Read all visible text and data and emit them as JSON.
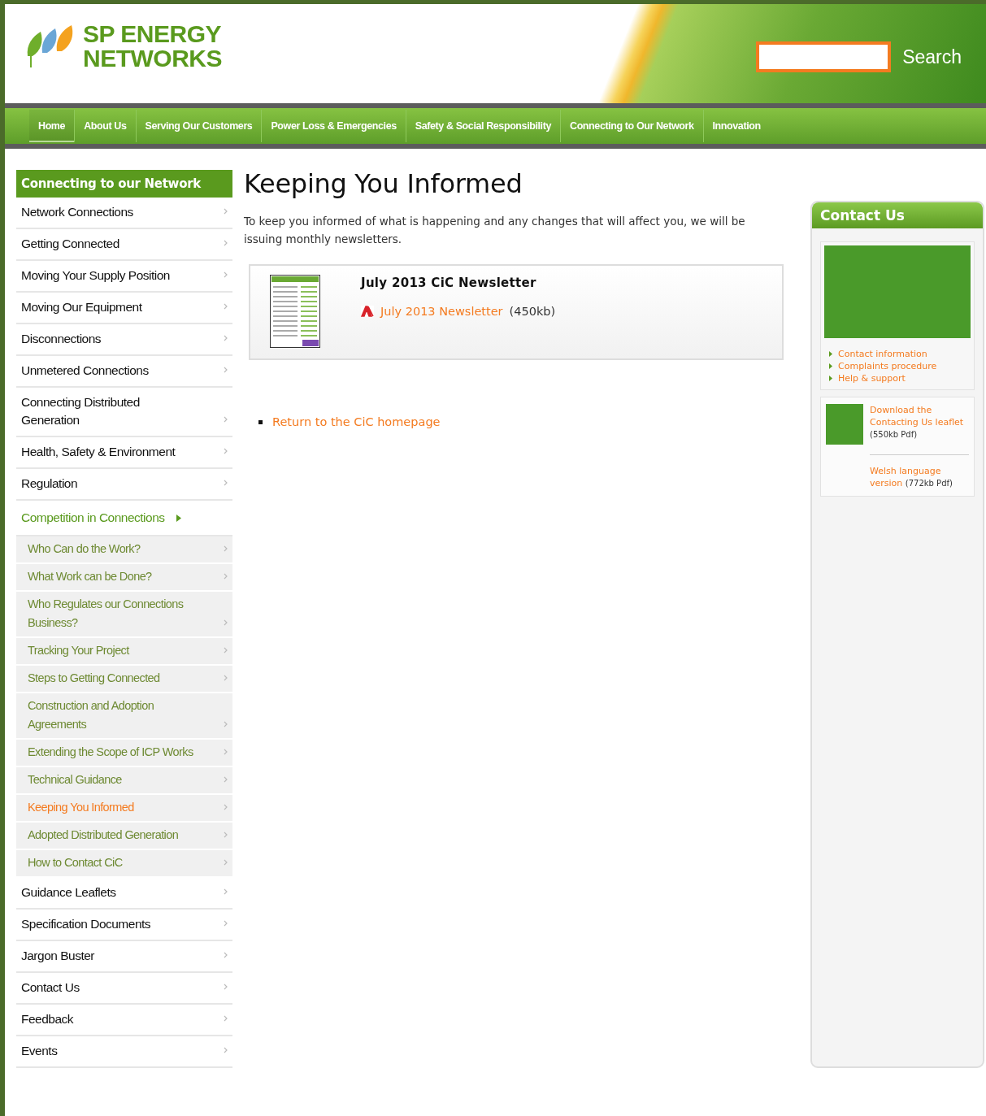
{
  "header": {
    "logo_lines": [
      "SP ENERGY",
      "NETWORKS"
    ],
    "search": {
      "button": "Search"
    }
  },
  "nav": [
    {
      "label": "Home",
      "selected": true
    },
    {
      "label": "About Us",
      "selected": false
    },
    {
      "label": "Serving Our Customers",
      "selected": false
    },
    {
      "label": "Power Loss & Emergencies",
      "selected": false
    },
    {
      "label": "Safety & Social Responsibility",
      "selected": false
    },
    {
      "label": "Connecting to Our Network",
      "selected": false
    },
    {
      "label": "Innovation",
      "selected": false
    }
  ],
  "sidebar": {
    "title": "Connecting to our Network",
    "items": [
      {
        "label": "Network Connections",
        "selected": false
      },
      {
        "label": "Getting Connected",
        "selected": false
      },
      {
        "label": "Moving Your Supply Position",
        "selected": false
      },
      {
        "label": "Moving Our Equipment",
        "selected": false
      },
      {
        "label": "Disconnections",
        "selected": false
      },
      {
        "label": "Unmetered Connections",
        "selected": false
      },
      {
        "label": "Connecting Distributed Generation",
        "selected": false
      },
      {
        "label": "Health, Safety & Environment",
        "selected": false
      },
      {
        "label": "Regulation",
        "selected": false
      },
      {
        "label": "Competition in Connections",
        "selected": true,
        "children": [
          {
            "label": "Who Can do the Work?",
            "selected": false
          },
          {
            "label": "What Work can be Done?",
            "selected": false
          },
          {
            "label": "Who Regulates our Connections Business?",
            "selected": false
          },
          {
            "label": "Tracking Your Project",
            "selected": false
          },
          {
            "label": "Steps to Getting Connected",
            "selected": false
          },
          {
            "label": "Construction and Adoption Agreements",
            "selected": false
          },
          {
            "label": "Extending the Scope of ICP Works",
            "selected": false
          },
          {
            "label": "Technical Guidance",
            "selected": false
          },
          {
            "label": "Keeping You Informed",
            "selected": true
          },
          {
            "label": "Adopted Distributed Generation",
            "selected": false
          },
          {
            "label": "How to Contact CiC",
            "selected": false
          }
        ]
      },
      {
        "label": "Guidance Leaflets",
        "selected": false
      },
      {
        "label": "Specification Documents",
        "selected": false
      },
      {
        "label": "Jargon Buster",
        "selected": false
      },
      {
        "label": "Contact Us",
        "selected": false
      },
      {
        "label": "Feedback",
        "selected": false
      },
      {
        "label": "Events",
        "selected": false
      }
    ]
  },
  "main": {
    "title": "Keeping You Informed",
    "intro": "To keep you informed of what is happening and any changes that will affect you, we will be issuing monthly newsletters.",
    "newsletter": {
      "title": "July 2013 CiC Newsletter",
      "link": "July 2013 Newsletter",
      "size": "(450kb)"
    },
    "return_link": "Return to the CiC homepage"
  },
  "contact_box": {
    "title": "Contact Us",
    "links": [
      "Contact information",
      "Complaints procedure",
      "Help & support"
    ],
    "downloads": [
      {
        "link": "Download the Contacting Us leaflet",
        "size": "(550kb Pdf)"
      },
      {
        "link": "Welsh language version",
        "size": "(772kb Pdf)"
      }
    ]
  }
}
